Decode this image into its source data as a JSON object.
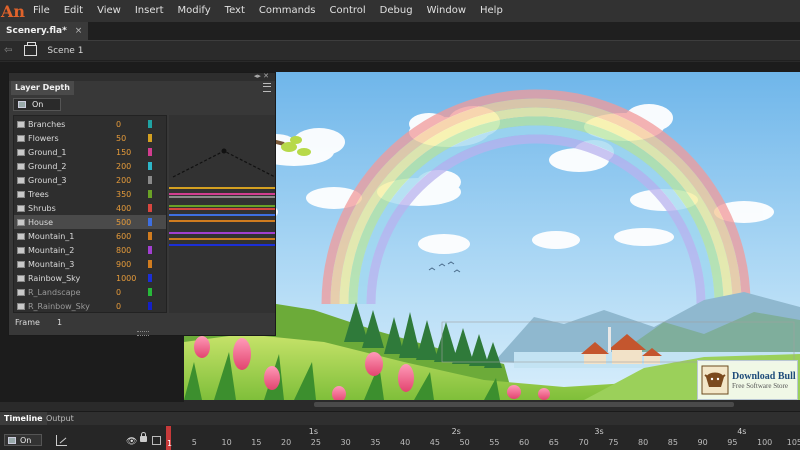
{
  "app": {
    "logo": "An"
  },
  "menu": [
    "File",
    "Edit",
    "View",
    "Insert",
    "Modify",
    "Text",
    "Commands",
    "Control",
    "Debug",
    "Window",
    "Help"
  ],
  "document": {
    "tab_title": "Scenery.fla*",
    "close_glyph": "×"
  },
  "editbar": {
    "scene_label": "Scene 1"
  },
  "layer_depth": {
    "tab": "Layer Depth",
    "toggle_label": "On",
    "layers": [
      {
        "name": "Branches",
        "depth": "0",
        "color": "#1fa3a3"
      },
      {
        "name": "Flowers",
        "depth": "50",
        "color": "#d4a021"
      },
      {
        "name": "Ground_1",
        "depth": "150",
        "color": "#d13d8f"
      },
      {
        "name": "Ground_2",
        "depth": "200",
        "color": "#2db6c8"
      },
      {
        "name": "Ground_3",
        "depth": "200",
        "color": "#8a8a8a"
      },
      {
        "name": "Trees",
        "depth": "350",
        "color": "#6aa126"
      },
      {
        "name": "Shrubs",
        "depth": "400",
        "color": "#d8463f"
      },
      {
        "name": "House",
        "depth": "500",
        "color": "#3e6fe0"
      },
      {
        "name": "Mountain_1",
        "depth": "600",
        "color": "#d07c1f"
      },
      {
        "name": "Mountain_2",
        "depth": "800",
        "color": "#a23fd0"
      },
      {
        "name": "Mountain_3",
        "depth": "900",
        "color": "#d07c1f"
      },
      {
        "name": "Rainbow_Sky",
        "depth": "1000",
        "color": "#1b2fd6"
      },
      {
        "name": "R_Landscape",
        "depth": "0",
        "color": "#27b83a"
      },
      {
        "name": "R_Rainbow_Sky",
        "depth": "0",
        "color": "#1420c8"
      }
    ],
    "selected_index": 7,
    "frame_label": "Frame",
    "frame_value": "1"
  },
  "watermark": {
    "title": "Download Bull",
    "subtitle": "Free Software Store"
  },
  "timeline": {
    "tabs": [
      "Timeline",
      "Output"
    ],
    "toggle_label": "On",
    "current_frame": "1",
    "seconds": [
      "1s",
      "2s",
      "3s",
      "4s"
    ],
    "frames": [
      "5",
      "10",
      "15",
      "20",
      "25",
      "30",
      "35",
      "40",
      "45",
      "50",
      "55",
      "60",
      "65",
      "70",
      "75",
      "80",
      "85",
      "90",
      "95",
      "100",
      "105"
    ]
  }
}
